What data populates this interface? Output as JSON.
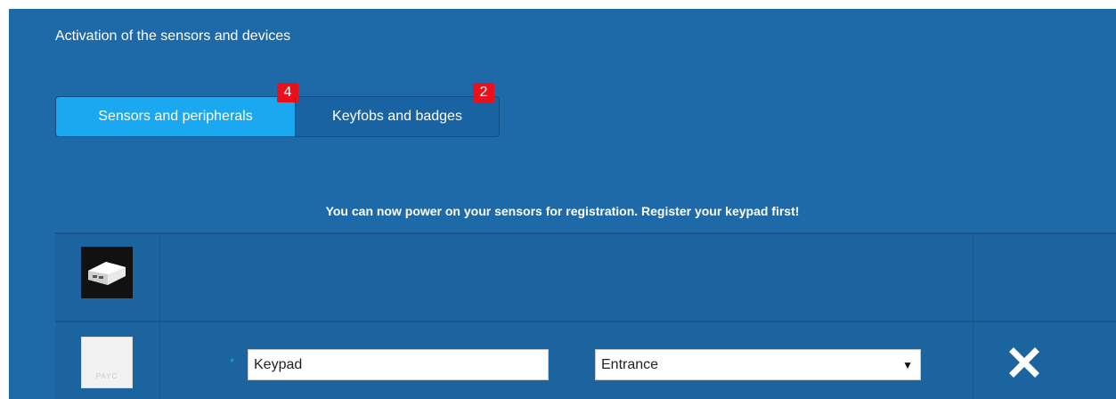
{
  "header": {
    "title": "Activation of the sensors and devices"
  },
  "tabs": [
    {
      "label": "Sensors and peripherals",
      "badge": "4",
      "active": true
    },
    {
      "label": "Keyfobs and badges",
      "badge": "2",
      "active": false
    }
  ],
  "message": "You can now power on your sensors for registration. Register your keypad first!",
  "devices": [
    {
      "image": "device-box-icon"
    },
    {
      "image": "keypad-icon",
      "image_text": "PAYC",
      "required_marker": "*",
      "name_value": "Keypad",
      "location_value": "Entrance",
      "delete_icon": "close-icon"
    }
  ],
  "colors": {
    "panel_bg": "#1e6aa8",
    "active_tab": "#1aa8f0",
    "badge": "#e8111b"
  }
}
